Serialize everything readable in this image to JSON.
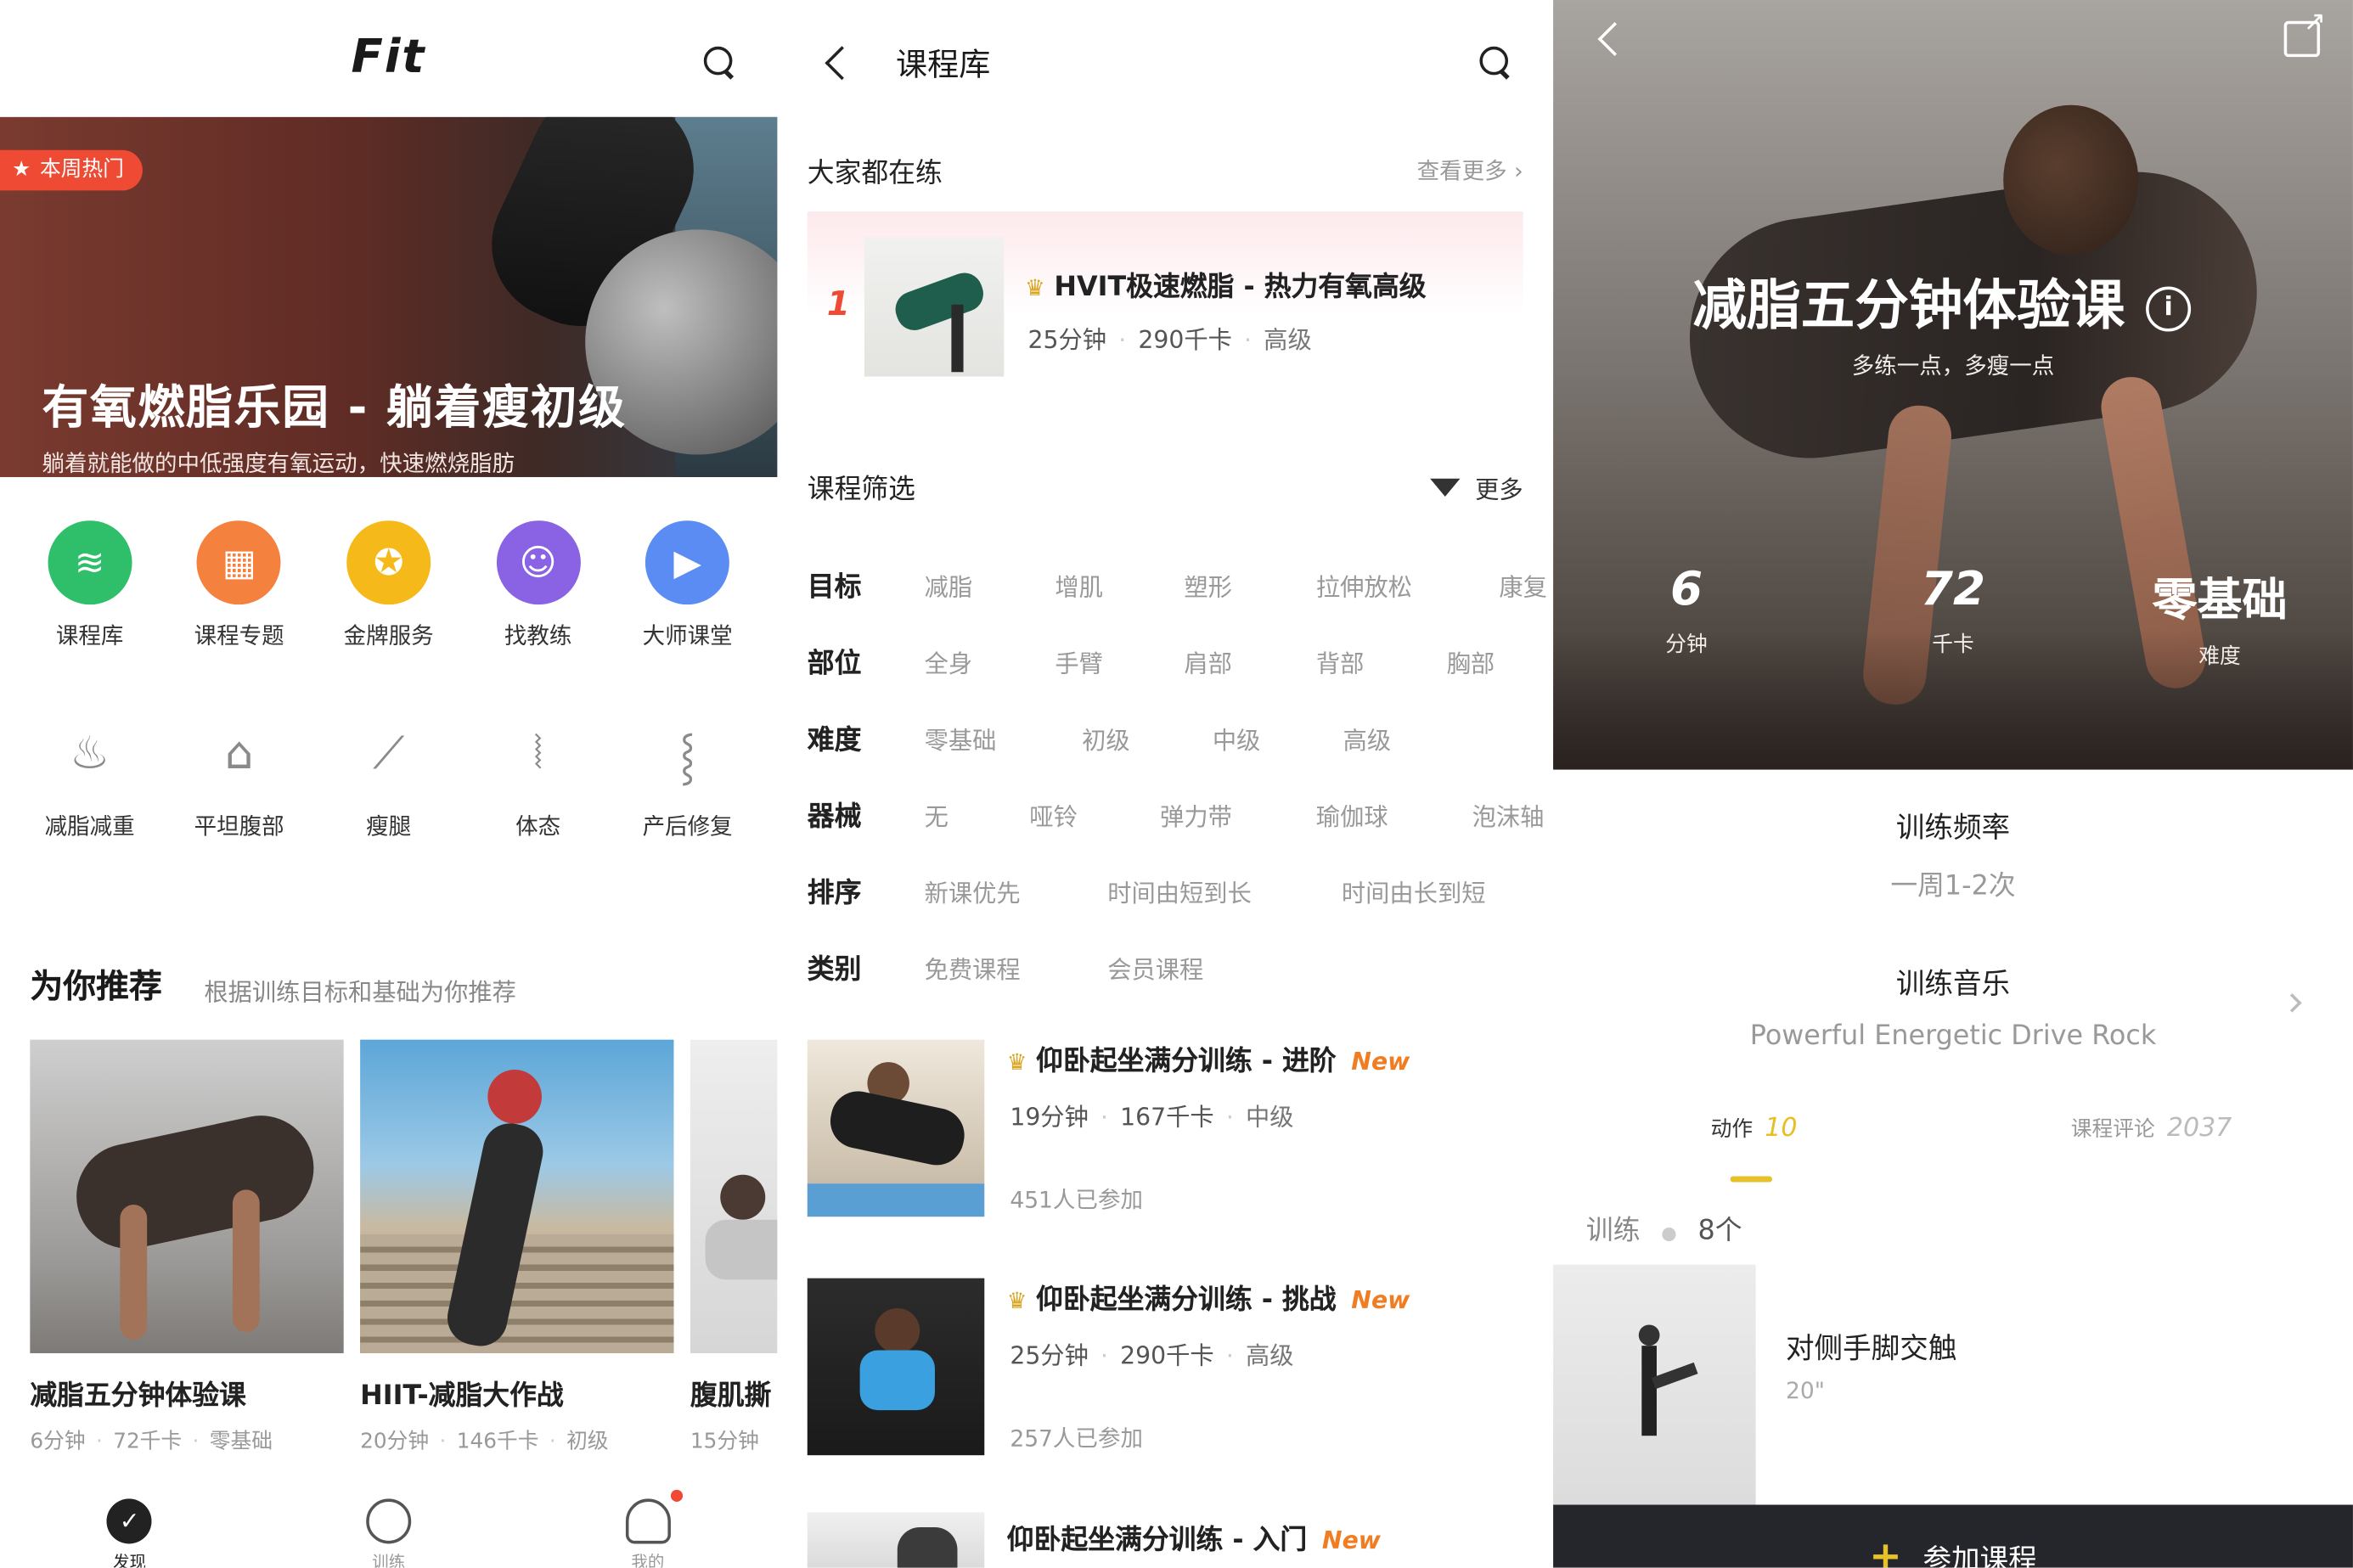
{
  "home": {
    "logo": "Fit",
    "banner": {
      "badge": "本周热门",
      "title": "有氧燃脂乐园 - 躺着瘦初级",
      "subtitle": "躺着就能做的中低强度有氧运动，快速燃烧脂肪"
    },
    "nav_top": [
      {
        "label": "课程库",
        "icon": "layers-icon",
        "color": "#2fbf6a"
      },
      {
        "label": "课程专题",
        "icon": "grid-icon",
        "color": "#f5813f"
      },
      {
        "label": "金牌服务",
        "icon": "medal-icon",
        "color": "#f6b91a"
      },
      {
        "label": "找教练",
        "icon": "coach-icon",
        "color": "#8a63e4"
      },
      {
        "label": "大师课堂",
        "icon": "video-icon",
        "color": "#5b8cf4"
      }
    ],
    "nav_bottom": [
      {
        "label": "减脂减重",
        "icon": "flame-icon"
      },
      {
        "label": "平坦腹部",
        "icon": "abs-icon"
      },
      {
        "label": "瘦腿",
        "icon": "leg-icon"
      },
      {
        "label": "体态",
        "icon": "posture-icon"
      },
      {
        "label": "产后修复",
        "icon": "recovery-icon"
      }
    ],
    "recommend": {
      "title": "为你推荐",
      "subtitle": "根据训练目标和基础为你推荐",
      "cards": [
        {
          "title": "减脂五分钟体验课",
          "meta": [
            "6分钟",
            "72千卡",
            "零基础"
          ]
        },
        {
          "title": "HIIT-减脂大作战",
          "meta": [
            "20分钟",
            "146千卡",
            "初级"
          ]
        },
        {
          "title": "腹肌撕",
          "meta": [
            "15分钟"
          ]
        }
      ]
    },
    "tabbar": [
      {
        "label": "发现",
        "icon": "discover-icon"
      },
      {
        "label": "训练",
        "icon": "stopwatch-icon"
      },
      {
        "label": "我的",
        "icon": "profile-icon"
      }
    ]
  },
  "library": {
    "title": "课程库",
    "popular": {
      "title": "大家都在练",
      "more": "查看更多",
      "item": {
        "rank": "1",
        "name": "HVIT极速燃脂 - 热力有氧高级",
        "duration": "25分钟",
        "calories": "290千卡",
        "level": "高级"
      }
    },
    "filter": {
      "title": "课程筛选",
      "more": "更多",
      "rows": [
        {
          "key": "目标",
          "values": [
            "减脂",
            "增肌",
            "塑形",
            "拉伸放松",
            "康复"
          ]
        },
        {
          "key": "部位",
          "values": [
            "全身",
            "手臂",
            "肩部",
            "背部",
            "胸部"
          ]
        },
        {
          "key": "难度",
          "values": [
            "零基础",
            "初级",
            "中级",
            "高级"
          ]
        },
        {
          "key": "器械",
          "values": [
            "无",
            "哑铃",
            "弹力带",
            "瑜伽球",
            "泡沫轴"
          ]
        },
        {
          "key": "排序",
          "values": [
            "新课优先",
            "时间由短到长",
            "时间由长到短"
          ]
        },
        {
          "key": "类别",
          "values": [
            "免费课程",
            "会员课程"
          ]
        }
      ]
    },
    "courses": [
      {
        "name": "仰卧起坐满分训练 - 进阶",
        "tag": "New",
        "duration": "19分钟",
        "calories": "167千卡",
        "level": "中级",
        "joined": "451人已参加"
      },
      {
        "name": "仰卧起坐满分训练 - 挑战",
        "tag": "New",
        "duration": "25分钟",
        "calories": "290千卡",
        "level": "高级",
        "joined": "257人已参加"
      },
      {
        "name": "仰卧起坐满分训练 - 入门",
        "tag": "New"
      }
    ]
  },
  "detail": {
    "title": "减脂五分钟体验课",
    "subtitle": "多练一点，多瘦一点",
    "stats": [
      {
        "value": "6",
        "label": "分钟"
      },
      {
        "value": "72",
        "label": "千卡"
      },
      {
        "value": "零基础",
        "label": "难度"
      }
    ],
    "frequency": {
      "title": "训练频率",
      "value": "一周1-2次"
    },
    "music": {
      "title": "训练音乐",
      "value": "Powerful Energetic Drive Rock"
    },
    "tabs": [
      {
        "label": "动作",
        "count": "10"
      },
      {
        "label": "课程评论",
        "count": "2037"
      }
    ],
    "training": {
      "label": "训练",
      "count": "8个"
    },
    "exercise": {
      "name": "对侧手脚交触",
      "time": "20\""
    },
    "join_button": "参加课程"
  }
}
